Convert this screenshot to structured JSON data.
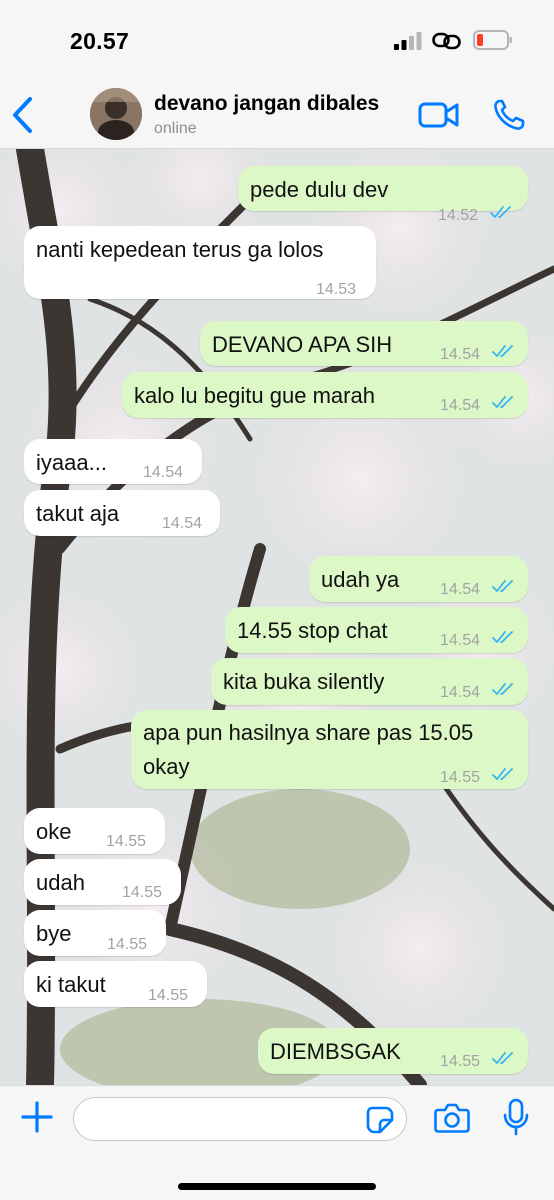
{
  "status_bar": {
    "time": "20.57"
  },
  "header": {
    "contact_name": "devano jangan dibales",
    "contact_status": "online"
  },
  "messages": [
    {
      "dir": "out",
      "text": "pede dulu dev",
      "time": "14.52",
      "ticks": "read"
    },
    {
      "dir": "in",
      "text": "nanti kepedean terus ga lolos",
      "time": "14.53"
    },
    {
      "dir": "out",
      "text": "DEVANO APA SIH",
      "time": "14.54",
      "ticks": "read"
    },
    {
      "dir": "out",
      "text": "kalo lu begitu gue marah",
      "time": "14.54",
      "ticks": "read"
    },
    {
      "dir": "in",
      "text": "iyaaa...",
      "time": "14.54"
    },
    {
      "dir": "in",
      "text": "takut aja",
      "time": "14.54"
    },
    {
      "dir": "out",
      "text": "udah ya",
      "time": "14.54",
      "ticks": "read"
    },
    {
      "dir": "out",
      "text": "14.55 stop chat",
      "time": "14.54",
      "ticks": "read"
    },
    {
      "dir": "out",
      "text": "kita buka silently",
      "time": "14.54",
      "ticks": "read"
    },
    {
      "dir": "out",
      "text": "apa pun hasilnya share pas 15.05 okay",
      "time": "14.55",
      "ticks": "read"
    },
    {
      "dir": "in",
      "text": "oke",
      "time": "14.55"
    },
    {
      "dir": "in",
      "text": "udah",
      "time": "14.55"
    },
    {
      "dir": "in",
      "text": "bye",
      "time": "14.55"
    },
    {
      "dir": "in",
      "text": "ki takut",
      "time": "14.55"
    },
    {
      "dir": "out",
      "text": "DIEMBSGAK",
      "time": "14.55",
      "ticks": "read"
    }
  ],
  "composer": {
    "placeholder": ""
  },
  "icons": {
    "back": "chevron-left-icon",
    "video": "video-camera-icon",
    "call": "phone-icon",
    "plus": "plus-icon",
    "sticker": "sticker-icon",
    "camera": "camera-icon",
    "mic": "microphone-icon",
    "tick": "double-check-icon"
  },
  "colors": {
    "accent": "#007aff",
    "outgoing_bubble": "#dcf8c6",
    "incoming_bubble": "#ffffff",
    "read_tick": "#34b7f1",
    "timestamp": "#a3a3a3"
  }
}
